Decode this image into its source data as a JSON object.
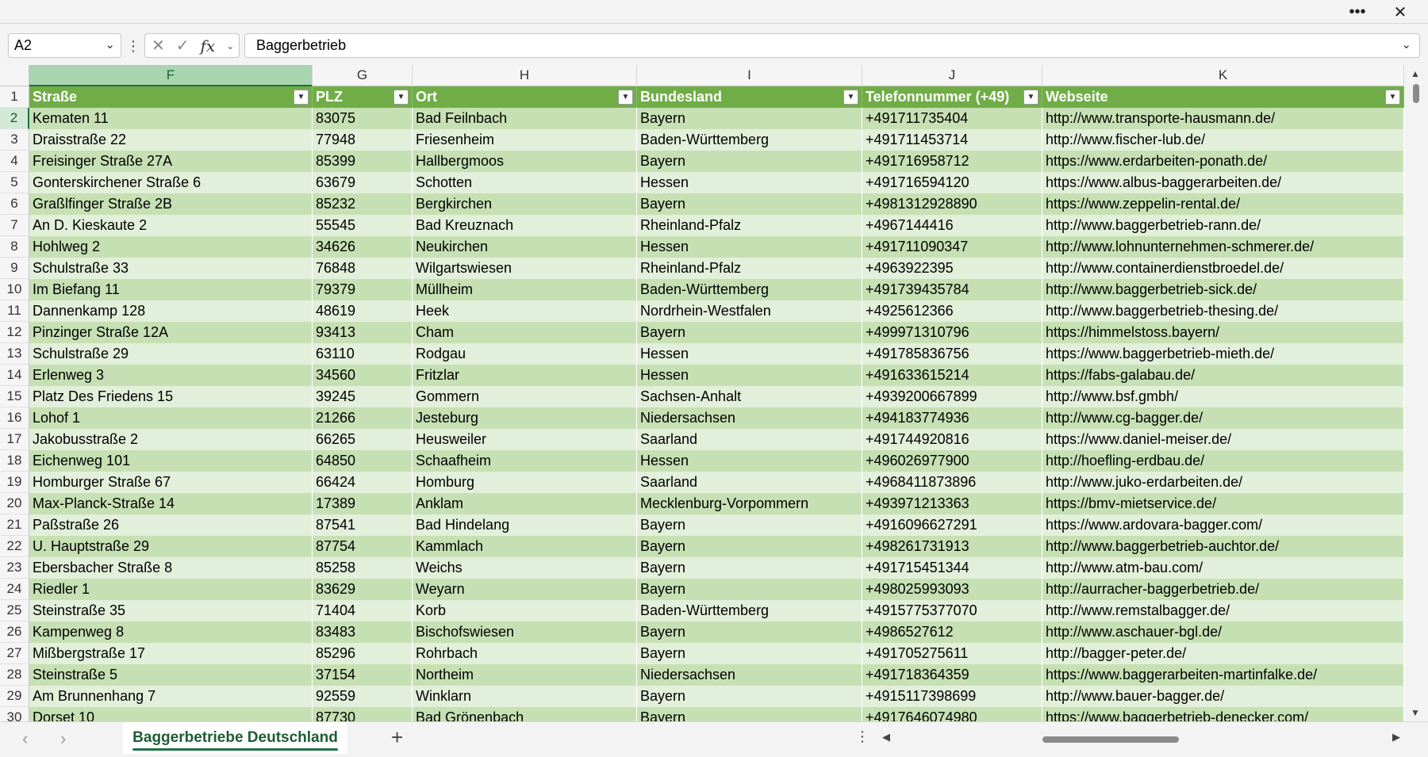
{
  "title_bar": {
    "more_icon": "ellipsis-icon",
    "close_icon": "close-icon"
  },
  "formula_bar": {
    "name_box": "A2",
    "formula": "Baggerbetrieb"
  },
  "columns": [
    "F",
    "G",
    "H",
    "I",
    "J",
    "K"
  ],
  "header_row": [
    "Straße",
    "PLZ",
    "Ort",
    "Bundesland",
    "Telefonnummer (+49)",
    "Webseite"
  ],
  "rows": [
    [
      "Kematen 11",
      "83075",
      "Bad Feilnbach",
      "Bayern",
      "+491711735404",
      "http://www.transporte-hausmann.de/"
    ],
    [
      "Draisstraße 22",
      "77948",
      "Friesenheim",
      "Baden-Württemberg",
      "+491711453714",
      "http://www.fischer-lub.de/"
    ],
    [
      "Freisinger Straße 27A",
      "85399",
      "Hallbergmoos",
      "Bayern",
      "+491716958712",
      "https://www.erdarbeiten-ponath.de/"
    ],
    [
      "Gonterskirchener Straße 6",
      "63679",
      "Schotten",
      "Hessen",
      "+491716594120",
      "https://www.albus-baggerarbeiten.de/"
    ],
    [
      "Graßlfinger Straße 2B",
      "85232",
      "Bergkirchen",
      "Bayern",
      "+4981312928890",
      "https://www.zeppelin-rental.de/"
    ],
    [
      "An D. Kieskaute 2",
      "55545",
      "Bad Kreuznach",
      "Rheinland-Pfalz",
      "+4967144416",
      "http://www.baggerbetrieb-rann.de/"
    ],
    [
      "Hohlweg 2",
      "34626",
      "Neukirchen",
      "Hessen",
      "+491711090347",
      "http://www.lohnunternehmen-schmerer.de/"
    ],
    [
      "Schulstraße 33",
      "76848",
      "Wilgartswiesen",
      "Rheinland-Pfalz",
      "+4963922395",
      "http://www.containerdienstbroedel.de/"
    ],
    [
      "Im Biefang 11",
      "79379",
      "Müllheim",
      "Baden-Württemberg",
      "+491739435784",
      "http://www.baggerbetrieb-sick.de/"
    ],
    [
      "Dannenkamp 128",
      "48619",
      "Heek",
      "Nordrhein-Westfalen",
      "+4925612366",
      "http://www.baggerbetrieb-thesing.de/"
    ],
    [
      "Pinzinger Straße 12A",
      "93413",
      "Cham",
      "Bayern",
      "+499971310796",
      "https://himmelstoss.bayern/"
    ],
    [
      "Schulstraße 29",
      "63110",
      "Rodgau",
      "Hessen",
      "+491785836756",
      "https://www.baggerbetrieb-mieth.de/"
    ],
    [
      "Erlenweg 3",
      "34560",
      "Fritzlar",
      "Hessen",
      "+491633615214",
      "https://fabs-galabau.de/"
    ],
    [
      "Platz Des Friedens 15",
      "39245",
      "Gommern",
      "Sachsen-Anhalt",
      "+4939200667899",
      "http://www.bsf.gmbh/"
    ],
    [
      "Lohof 1",
      "21266",
      "Jesteburg",
      "Niedersachsen",
      "+494183774936",
      "http://www.cg-bagger.de/"
    ],
    [
      "Jakobusstraße 2",
      "66265",
      "Heusweiler",
      "Saarland",
      "+491744920816",
      "https://www.daniel-meiser.de/"
    ],
    [
      "Eichenweg 101",
      "64850",
      "Schaafheim",
      "Hessen",
      "+496026977900",
      "http://hoefling-erdbau.de/"
    ],
    [
      "Homburger Straße 67",
      "66424",
      "Homburg",
      "Saarland",
      "+4968411873896",
      "http://www.juko-erdarbeiten.de/"
    ],
    [
      "Max-Planck-Straße 14",
      "17389",
      "Anklam",
      "Mecklenburg-Vorpommern",
      "+493971213363",
      "https://bmv-mietservice.de/"
    ],
    [
      "Paßstraße 26",
      "87541",
      "Bad Hindelang",
      "Bayern",
      "+4916096627291",
      "https://www.ardovara-bagger.com/"
    ],
    [
      "U. Hauptstraße 29",
      "87754",
      "Kammlach",
      "Bayern",
      "+498261731913",
      "http://www.baggerbetrieb-auchtor.de/"
    ],
    [
      "Ebersbacher Straße 8",
      "85258",
      "Weichs",
      "Bayern",
      "+491715451344",
      "http://www.atm-bau.com/"
    ],
    [
      "Riedler 1",
      "83629",
      "Weyarn",
      "Bayern",
      "+498025993093",
      "http://aurracher-baggerbetrieb.de/"
    ],
    [
      "Steinstraße 35",
      "71404",
      "Korb",
      "Baden-Württemberg",
      "+4915775377070",
      "http://www.remstalbagger.de/"
    ],
    [
      "Kampenweg 8",
      "83483",
      "Bischofswiesen",
      "Bayern",
      "+4986527612",
      "http://www.aschauer-bgl.de/"
    ],
    [
      "Mißbergstraße 17",
      "85296",
      "Rohrbach",
      "Bayern",
      "+491705275611",
      "http://bagger-peter.de/"
    ],
    [
      "Steinstraße 5",
      "37154",
      "Northeim",
      "Niedersachsen",
      "+491718364359",
      "https://www.baggerarbeiten-martinfalke.de/"
    ],
    [
      "Am Brunnenhang 7",
      "92559",
      "Winklarn",
      "Bayern",
      "+4915117398699",
      "http://www.bauer-bagger.de/"
    ],
    [
      "Dorset 10",
      "87730",
      "Bad Grönenbach",
      "Bayern",
      "+4917646074980",
      "https://www.baggerbetrieb-denecker.com/"
    ]
  ],
  "sheet_tab": "Baggerbetriebe Deutschland",
  "colors": {
    "header_green": "#70ad47",
    "band_light": "#e2efda",
    "band_dark": "#c6e0b4",
    "accent": "#1e7145"
  }
}
